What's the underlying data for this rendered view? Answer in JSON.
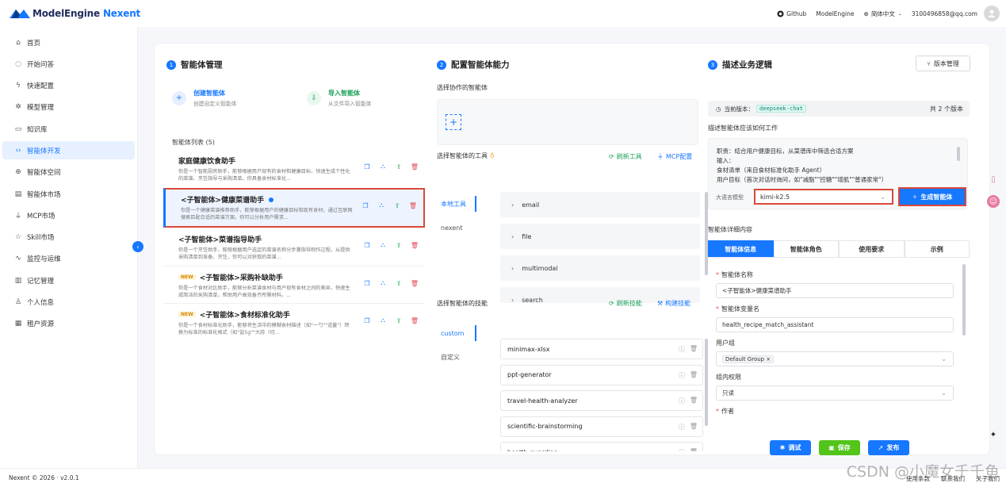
{
  "header": {
    "brand": "ModelEngine",
    "brand_product": "Nexent",
    "links": [
      "Github",
      "ModelEngine"
    ],
    "language": "简体中文",
    "user_email": "3100496858@qq.com"
  },
  "sidebar": {
    "items": [
      {
        "label": "首页",
        "icon": "home-icon"
      },
      {
        "label": "开始问答",
        "icon": "chat-icon"
      },
      {
        "label": "快速配置",
        "icon": "bolt-icon"
      },
      {
        "label": "模型管理",
        "icon": "model-icon"
      },
      {
        "label": "知识库",
        "icon": "book-icon"
      },
      {
        "label": "智能体开发",
        "icon": "code-icon",
        "active": true
      },
      {
        "label": "智能体空间",
        "icon": "globe-icon"
      },
      {
        "label": "智能体市场",
        "icon": "store-icon"
      },
      {
        "label": "MCP市场",
        "icon": "plug-icon"
      },
      {
        "label": "Skill市场",
        "icon": "star-icon"
      },
      {
        "label": "监控与运维",
        "icon": "pulse-icon"
      },
      {
        "label": "记忆管理",
        "icon": "memory-icon"
      },
      {
        "label": "个人信息",
        "icon": "user-icon"
      },
      {
        "label": "租户资源",
        "icon": "tenant-icon"
      }
    ]
  },
  "col1": {
    "step": "1",
    "title": "智能体管理",
    "create": {
      "title": "创建智能体",
      "sub": "创建自定义智能体"
    },
    "import": {
      "title": "导入智能体",
      "sub": "从文件导入智能体"
    },
    "list_title": "智能体列表 (5)",
    "agents": [
      {
        "name": "家庭健康饮食助手",
        "desc": "你是一个智能厨房助手，能够根据用户现有的食材和健康目标，快速生成个性化的菜谱、烹饪指导与采购清单。你具备食材标准化...",
        "new": false,
        "selected": false
      },
      {
        "name": "<子智能体>健康菜谱助手",
        "desc": "你是一个健康菜谱推荐助手，能够根据用户的健康目标和现有食材，通过互联网搜索匹配合适的菜谱方案。你可以分析用户需求...",
        "new": false,
        "selected": true
      },
      {
        "name": "<子智能体>菜谱指导助手",
        "desc": "你是一个烹饪助手，能够根据用户选定的菜谱名称分步骤指导制作过程。从提供采购清单到准备、烹饪，你可以对获取的菜谱...",
        "new": false,
        "selected": false
      },
      {
        "name": "<子智能体>采购补缺助手",
        "desc": "你是一个食材对比助手，能够分析菜谱食材与用户现有食材之间的差异，快速生成简洁的采购清单，帮助用户高效备齐所需材料。...",
        "new": true,
        "selected": false
      },
      {
        "name": "<子智能体>食材标准化助手",
        "desc": "你是一个食材标准化助手，能够将生活中的模糊食材描述（如\"一勺\"\"适量\"）转换为标准的标准化格式（如\"盐5g\"\"大蒜（切...",
        "new": true,
        "selected": false
      }
    ],
    "new_badge": "NEW"
  },
  "col2": {
    "step": "2",
    "title": "配置智能体能力",
    "collab_label": "选择协作的智能体",
    "tools_label": "选择智能体的工具",
    "refresh_tools": "刷新工具",
    "mcp_config": "MCP配置",
    "tool_tabs": [
      "本地工具",
      "nexent"
    ],
    "tools": [
      "email",
      "file",
      "multimodal",
      "search"
    ],
    "skills_label": "选择智能体的技能",
    "refresh_skills": "刷新技能",
    "build_skills": "构建技能",
    "skill_tabs": [
      "custom",
      "自定义"
    ],
    "skills": [
      "minimax-xlsx",
      "ppt-generator",
      "travel-health-analyzer",
      "scientific-brainstorming",
      "health-guardian"
    ]
  },
  "col3": {
    "step": "3",
    "title": "描述业务逻辑",
    "version_btn": "版本管理",
    "current_version_label": "当前版本：",
    "current_version": "deepseek-chat",
    "version_count": "共 2 个版本",
    "desc_label": "描述智能体应该如何工作",
    "desc_lines": [
      "职责：结合用户健康目标，从菜谱库中筛选合适方案",
      "输入：",
      "食材清单（来自食材标准化助手 Agent）",
      "用户目标（首次对话时询问，如\"减脂\"\"控糖\"\"增肌\"\"普通家常\"）"
    ],
    "model_label": "大语言模型",
    "model_value": "kimi-k2.5",
    "generate_btn": "生成智能体",
    "detail_label": "智能体详细内容",
    "detail_tabs": [
      "智能体信息",
      "智能体角色",
      "使用要求",
      "示例"
    ],
    "fields": {
      "name_label": "智能体名称",
      "name_value": "<子智能体>健康菜谱助手",
      "var_label": "智能体变量名",
      "var_value": "health_recipe_match_assistant",
      "group_label": "用户组",
      "group_value": "Default Group",
      "perm_label": "组内权限",
      "perm_value": "只读",
      "author_label": "作者"
    },
    "buttons": {
      "debug": "调试",
      "save": "保存",
      "publish": "发布"
    }
  },
  "footer": {
    "copyright": "Nexent © 2026 · v2.0.1",
    "links": [
      "使用条款",
      "联系我们",
      "关于我们"
    ]
  },
  "watermark": "CSDN @小魔女千千鱼",
  "colors": {
    "accent": "#1677ff",
    "save": "#52c41a",
    "highlight": "#d9483b"
  }
}
